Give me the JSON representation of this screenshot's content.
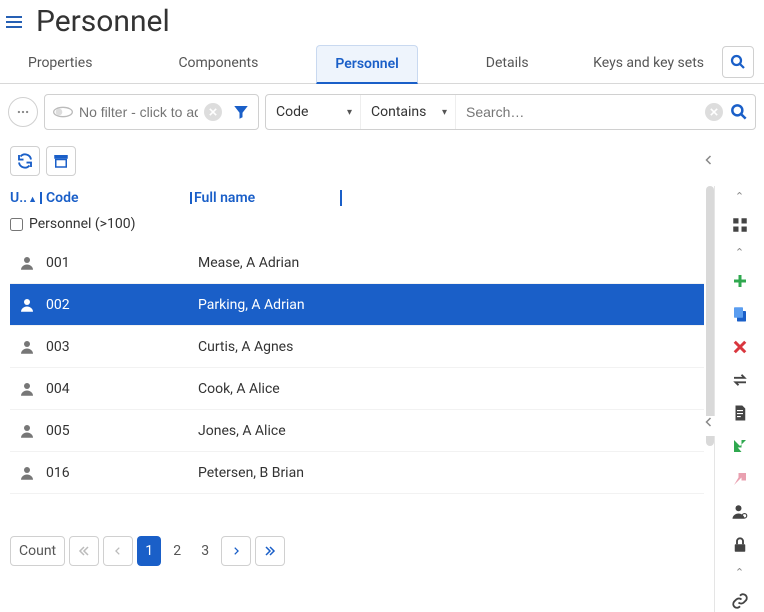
{
  "header": {
    "title": "Personnel"
  },
  "tabs": [
    {
      "label": "Properties",
      "active": false
    },
    {
      "label": "Components",
      "active": false
    },
    {
      "label": "Personnel",
      "active": true
    },
    {
      "label": "Details",
      "active": false
    },
    {
      "label": "Keys and key sets",
      "active": false
    }
  ],
  "filter": {
    "placeholder": "No filter - click to add",
    "value": "",
    "field_select": "Code",
    "operator_select": "Contains",
    "search_placeholder": "Search…",
    "search_value": ""
  },
  "table": {
    "columns": {
      "u": "U..",
      "code": "Code",
      "name": "Full name"
    },
    "group_label": "Personnel (>100)",
    "rows": [
      {
        "code": "001",
        "name": "Mease, A Adrian",
        "selected": false
      },
      {
        "code": "002",
        "name": "Parking, A Adrian",
        "selected": true
      },
      {
        "code": "003",
        "name": "Curtis, A Agnes",
        "selected": false
      },
      {
        "code": "004",
        "name": "Cook, A Alice",
        "selected": false
      },
      {
        "code": "005",
        "name": "Jones, A Alice",
        "selected": false
      },
      {
        "code": "016",
        "name": "Petersen, B Brian",
        "selected": false
      }
    ]
  },
  "pagination": {
    "count_label": "Count",
    "pages": [
      "1",
      "2",
      "3"
    ],
    "current": "1"
  },
  "rail_icons": [
    "chevron-up-icon",
    "grid-icon",
    "chevron-up-icon",
    "plus-icon",
    "copy-icon",
    "delete-icon",
    "swap-icon",
    "document-icon",
    "import-icon",
    "export-icon",
    "person-gear-icon",
    "lock-icon",
    "chevron-up-icon",
    "link-icon"
  ]
}
